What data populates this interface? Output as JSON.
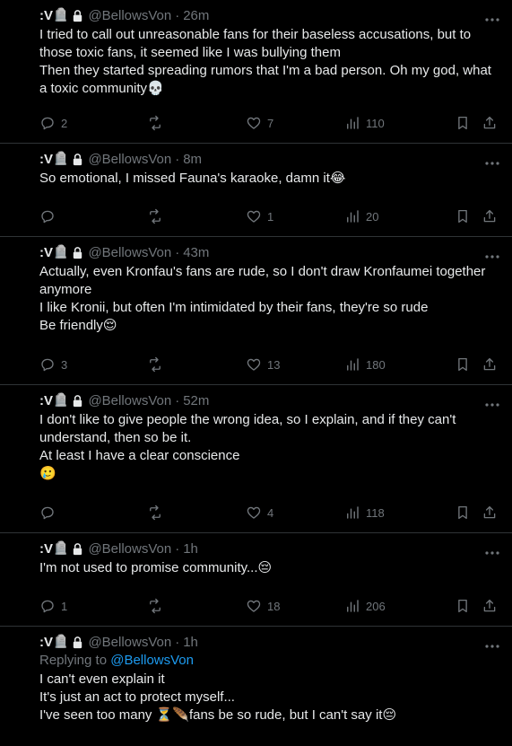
{
  "tweets": [
    {
      "name": ":V",
      "name_emoji": "🪦",
      "handle": "@BellowsVon",
      "time": "26m",
      "lines": [
        "I tried to call out unreasonable fans for their baseless accusations, but to those toxic fans, it seemed like I was bullying them",
        "Then they started spreading rumors that I'm a bad person. Oh my god, what a toxic community💀"
      ],
      "replies": "2",
      "retweets": "",
      "likes": "7",
      "views": "110"
    },
    {
      "name": ":V",
      "name_emoji": "🪦",
      "handle": "@BellowsVon",
      "time": "8m",
      "lines": [
        "So emotional, I missed Fauna's karaoke, damn it😂"
      ],
      "replies": "",
      "retweets": "",
      "likes": "1",
      "views": "20"
    },
    {
      "name": ":V",
      "name_emoji": "🪦",
      "handle": "@BellowsVon",
      "time": "43m",
      "lines": [
        "Actually, even Kronfau's fans are rude, so I don't draw Kronfaumei together anymore",
        "I like Kronii, but often I'm intimidated by their fans, they're so rude",
        "Be friendly😌"
      ],
      "replies": "3",
      "retweets": "",
      "likes": "13",
      "views": "180"
    },
    {
      "name": ":V",
      "name_emoji": "🪦",
      "handle": "@BellowsVon",
      "time": "52m",
      "lines": [
        "I don't like to give people the wrong idea, so I explain, and if they can't understand, then so be it.",
        "At least I have a clear conscience",
        "🥲"
      ],
      "replies": "",
      "retweets": "",
      "likes": "4",
      "views": "118"
    },
    {
      "name": ":V",
      "name_emoji": "🪦",
      "handle": "@BellowsVon",
      "time": "1h",
      "lines": [
        "I'm not used to promise community...😔"
      ],
      "replies": "1",
      "retweets": "",
      "likes": "18",
      "views": "206"
    },
    {
      "name": ":V",
      "name_emoji": "🪦",
      "handle": "@BellowsVon",
      "time": "1h",
      "replying_prefix": "Replying to",
      "replying_to": "@BellowsVon",
      "lines": [
        "I can't even explain it",
        "It's just an act to protect myself...",
        "I've seen too many ⏳🪶fans be so rude, but I can't say it😔"
      ]
    }
  ],
  "sep": "·",
  "colors": {
    "background": "#000000",
    "text": "#e7e9ea",
    "muted": "#71767b",
    "link": "#1d9bf0",
    "divider": "#2f3336"
  },
  "icons": [
    "lock-icon",
    "more-icon",
    "reply-icon",
    "retweet-icon",
    "like-icon",
    "views-icon",
    "bookmark-icon",
    "share-icon"
  ]
}
